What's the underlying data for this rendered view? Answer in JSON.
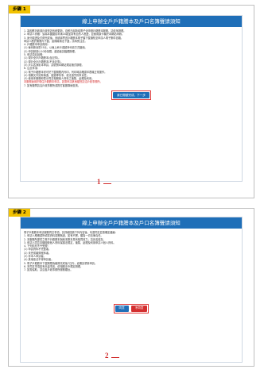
{
  "step1": {
    "tag": "步驟 1",
    "title": "線上申辦全戶戶籍謄本及戶口名簿聲請須知",
    "paragraphs": [
      "1. 為因應內政部戶政資訊系統更新，自即日起新增電子化申辦戶籍謄本服務，請依序辦理。",
      "2. 申請人資格：須為本國國民年滿18歲並持有自然人憑證，並使用讀卡機於本網站申辦。",
      "3. 身分驗證及付費完成後，系統將寄送戶籍謄本電子檔下載通知至申請人電子郵件信箱，",
      "   申請人應於期限內下載，逾期將無法下載，請特別注意。",
      "4. 戶籍謄本申請費用：",
      "   (1) 每份新臺幣15元，以線上刷卡或超商代收方式繳納。",
      "   (2) 申請數量以10份為限，超過者請臨櫃辦理。",
      "5. 申請項目說明：",
      "   (1) 現戶全戶戶籍謄本(含記事)。",
      "   (2) 現戶全戶戶籍謄本(不含記事)。",
      "   (3) 戶口名簿影本申請，請依照本網站規定格式辦理。",
      "6. 注意事項：",
      "   (1) 電子戶籍謄本僅可於下載期限內列印，列印時請確認印表機正常運作。",
      "   (2) 相關文件如有偽造、變造等情事，依法追究刑事責任。",
      "   (3) 使用本服務即表示同意相關個人資料之蒐集、處理及利用。",
      "7. 如有疑問請洽戶政事務所或撥打客服專線查詢。"
    ],
    "red_note": "本服務適用於現住戶籍謄本申請，如需申請其他類別請洽戶政事務所。",
    "next_label": "我已閱讀完成，下一步",
    "marker": "1"
  },
  "step2": {
    "tag": "步驟 2",
    "title": "線上申辦全戶戶籍謄本及戶口名簿聲請須知",
    "paragraphs": [
      "電子戶籍謄本申請服務同意事項，請詳細閱讀下列內容後，勾選同意並按確定繼續：",
      "1. 申請人應確認所填寫資料真實無誤，如有不實，願負一切法律責任。",
      "2. 本服務所提供之電子戶籍謄本與紙本謄本具有相同效力，請妥善保存。",
      "3. 申請人同意本機關依個人資料保護法規定，蒐集、處理及利用申請人個人資料。",
      "4. 下列情形不予受理：",
      "   (1) 申請資料不完整者。",
      "   (2) 未完成繳費程序者。",
      "   (3) 非本人申請者。",
      "   (4) 其他依法不得申請者。",
      "5. 電子戶籍謄本下載期限為繳費完成後7日內，逾期請重新申請。",
      "6. 本同意事項如有未盡事宜，依相關法令規定辦理。",
      "7. 如需協助，請洽各戶政事務所服務櫃台。"
    ],
    "agree_label": "同意",
    "disagree_label": "不同意",
    "marker": "2"
  }
}
